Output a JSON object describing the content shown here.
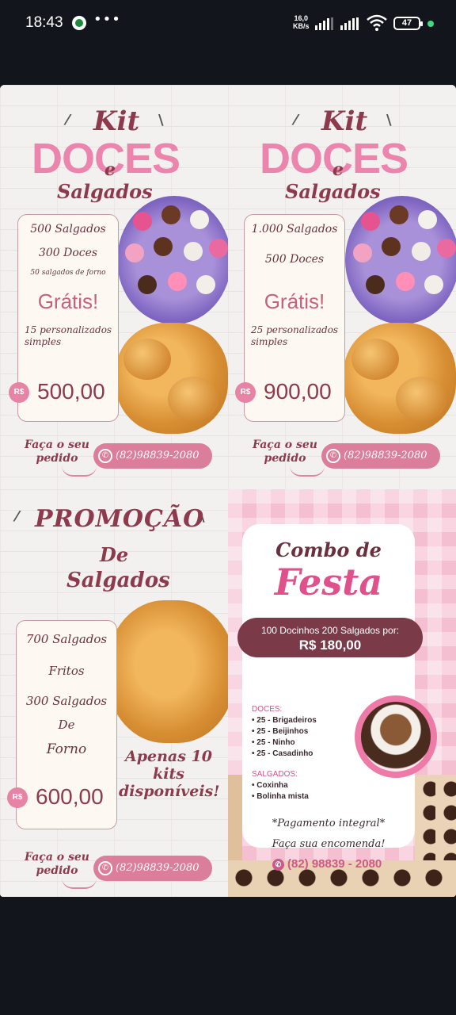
{
  "status_bar": {
    "time": "18:43",
    "net_speed_value": "16,0",
    "net_speed_unit": "KB/s",
    "battery": "47"
  },
  "kit1": {
    "title_kit": "Kit",
    "title_doces": "DOCES",
    "title_e": "e",
    "title_salgados": "Salgados",
    "line1": "500 Salgados",
    "line2": "300 Doces",
    "line3": "50 salgados de forno",
    "gratis": "Grátis!",
    "extra": "15 personalizados simples",
    "currency": "R$",
    "price": "500,00",
    "order_text": "Faça o seu pedido",
    "phone": "(82)98839-2080"
  },
  "kit2": {
    "title_kit": "Kit",
    "title_doces": "DOCES",
    "title_e": "e",
    "title_salgados": "Salgados",
    "line1": "1.000 Salgados",
    "line2": "500 Doces",
    "gratis": "Grátis!",
    "extra": "25 personalizados simples",
    "currency": "R$",
    "price": "900,00",
    "order_text": "Faça o seu pedido",
    "phone": "(82)98839-2080"
  },
  "promo": {
    "title": "PROMOÇÃO",
    "de": "De",
    "salgados": "Salgados",
    "line1": "700 Salgados",
    "line2": "Fritos",
    "line3": "300 Salgados",
    "line4": "De",
    "line5": "Forno",
    "currency": "R$",
    "price": "600,00",
    "apenas": "Apenas 10 kits disponíveis!",
    "order_text": "Faça o seu pedido",
    "phone": "(82)98839-2080"
  },
  "combo": {
    "title_combo": "Combo de",
    "title_festa": "Festa",
    "banner_line": "100 Docinhos 200 Salgados por:",
    "banner_price": "R$ 180,00",
    "doces_head": "DOCES:",
    "doces": [
      "• 25 - Brigadeiros",
      "• 25 - Beijinhos",
      "• 25 - Ninho",
      "• 25 - Casadinho"
    ],
    "salgados_head": "SALGADOS:",
    "salgados": [
      "• Coxinha",
      "• Bolinha mista"
    ],
    "payment": "*Pagamento integral*",
    "encomenda": "Faça sua encomenda!",
    "phone": "(82) 98839 - 2080"
  }
}
